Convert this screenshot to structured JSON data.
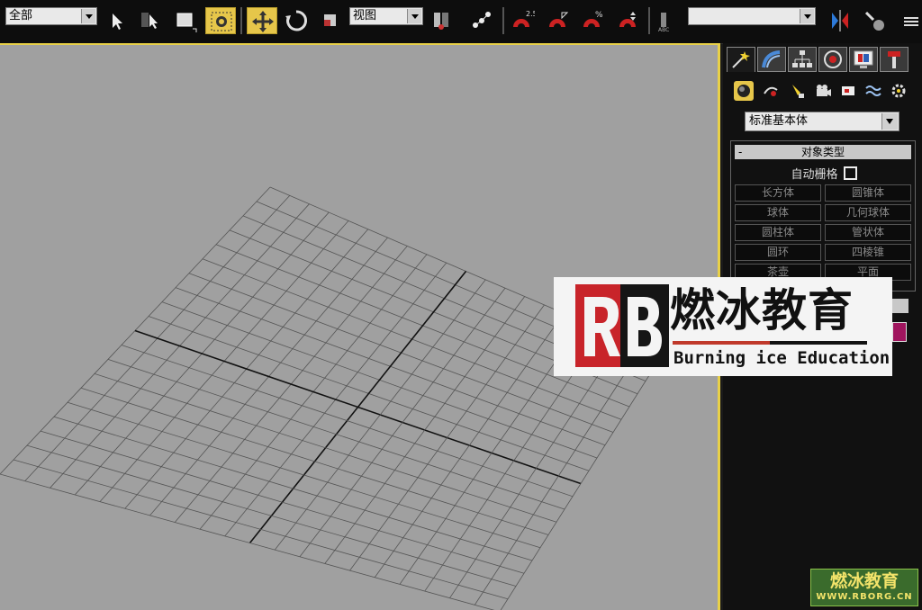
{
  "toolbar": {
    "selection_filter": "全部",
    "reference_coord": "视图",
    "named_selection": ""
  },
  "command_panel": {
    "category": "标准基本体",
    "rollout_title": "对象类型",
    "rollout_toggle": "-",
    "autogrid_label": "自动栅格",
    "object_buttons": [
      "长方体",
      "圆锥体",
      "球体",
      "几何球体",
      "圆柱体",
      "管状体",
      "圆环",
      "四棱锥",
      "茶壶",
      "平面"
    ],
    "color_swatch": "#a0155e"
  },
  "watermark": {
    "cn": "燃冰教育",
    "en": "Burning ice Education",
    "small_cn": "燃冰教育",
    "small_url": "WWW.RBORG.CN"
  },
  "colors": {
    "viewport_bg": "#a0a0a0",
    "active_border": "#e8d048",
    "grid_line": "#555555",
    "grid_axis": "#111111",
    "active_tool": "#e6c64a"
  }
}
